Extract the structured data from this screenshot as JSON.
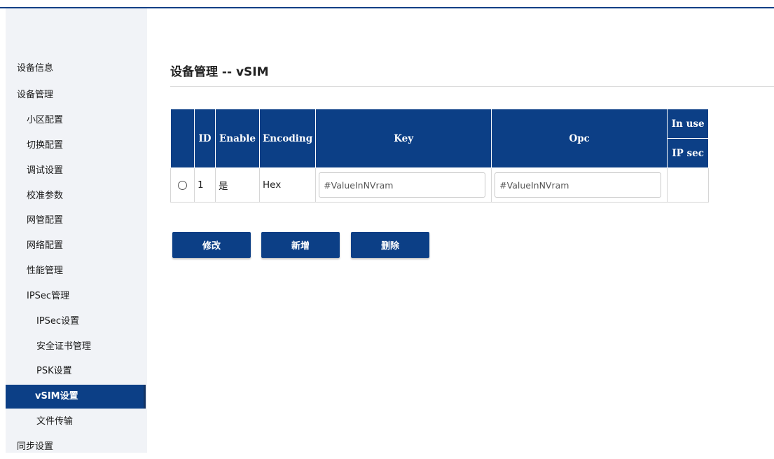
{
  "sidebar": {
    "items": [
      {
        "label": "设备信息"
      },
      {
        "label": "设备管理"
      },
      {
        "label": "小区配置"
      },
      {
        "label": "切换配置"
      },
      {
        "label": "调试设置"
      },
      {
        "label": "校准参数"
      },
      {
        "label": "网管配置"
      },
      {
        "label": "网络配置"
      },
      {
        "label": "性能管理"
      },
      {
        "label": "IPSec管理"
      },
      {
        "label": "IPSec设置"
      },
      {
        "label": "安全证书管理"
      },
      {
        "label": "PSK设置"
      },
      {
        "label": "vSIM设置"
      },
      {
        "label": "文件传输"
      },
      {
        "label": "同步设置"
      }
    ],
    "active": "vSIM设置"
  },
  "page": {
    "title": "设备管理 -- vSIM"
  },
  "table": {
    "headers": {
      "id": "ID",
      "enable": "Enable",
      "encoding": "Encoding",
      "key": "Key",
      "opc": "Opc",
      "inuse": "In use",
      "ipsec": "IP sec"
    },
    "rows": [
      {
        "id": "1",
        "enable": "是",
        "encoding": "Hex",
        "key": "#ValueInNVram",
        "opc": "#ValueInNVram",
        "inuse": ""
      }
    ]
  },
  "buttons": {
    "modify": "修改",
    "add": "新增",
    "delete": "删除"
  },
  "colors": {
    "accent": "#0c3f86",
    "sidebar_bg": "#f1f3f7"
  }
}
